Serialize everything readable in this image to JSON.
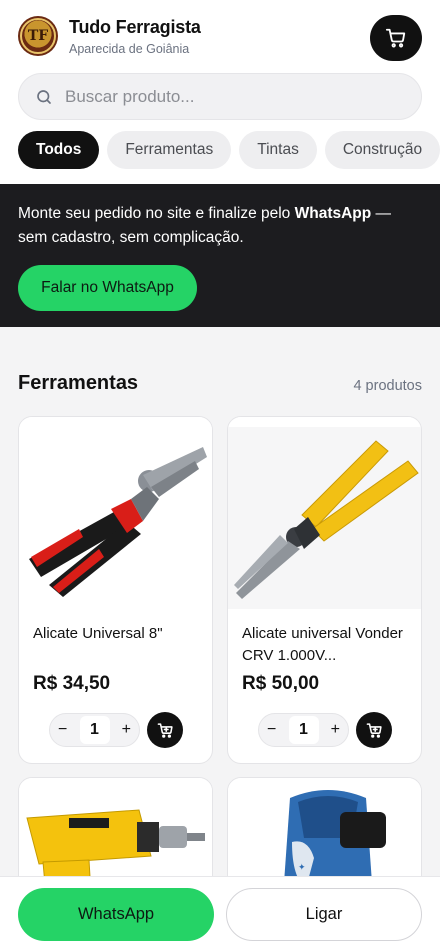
{
  "header": {
    "store_name": "Tudo Ferragista",
    "store_city": "Aparecida de Goiânia",
    "logo_text": "TF",
    "cart_icon": "shopping-cart-icon"
  },
  "search": {
    "placeholder": "Buscar produto...",
    "icon": "search-icon"
  },
  "categories": [
    {
      "label": "Todos",
      "active": true
    },
    {
      "label": "Ferramentas",
      "active": false
    },
    {
      "label": "Tintas",
      "active": false
    },
    {
      "label": "Construção",
      "active": false
    }
  ],
  "promo": {
    "text_before": "Monte seu pedido no site e finalize pelo ",
    "text_bold": "WhatsApp",
    "text_after": " — sem cadastro, sem complicação.",
    "button_label": "Falar no WhatsApp"
  },
  "section": {
    "title": "Ferramentas",
    "count": "4 produtos"
  },
  "products": [
    {
      "name": "Alicate Universal 8\"",
      "price": "R$ 34,50",
      "qty": "1"
    },
    {
      "name": "Alicate universal Vonder CRV 1.000V...",
      "price": "R$ 50,00",
      "qty": "1"
    },
    {
      "name": "",
      "price": "",
      "qty": ""
    },
    {
      "name": "",
      "price": "",
      "qty": ""
    }
  ],
  "stepper": {
    "minus": "−",
    "plus": "+"
  },
  "bottom": {
    "whatsapp_label": "WhatsApp",
    "call_label": "Ligar"
  },
  "colors": {
    "accent_green": "#25d366",
    "dark": "#111111",
    "promo_bg": "#1c1c1f"
  }
}
